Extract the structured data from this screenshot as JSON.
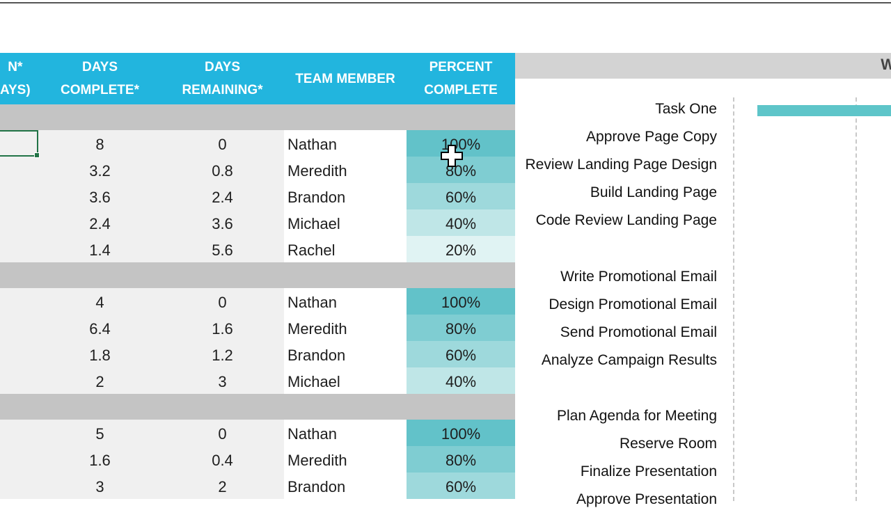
{
  "header": {
    "duration": [
      "N*",
      "AYS)"
    ],
    "days_complete": [
      "DAYS",
      "COMPLETE*"
    ],
    "days_remaining": [
      "DAYS",
      "REMAINING*"
    ],
    "team_member": "TEAM MEMBER",
    "percent_complete": [
      "PERCENT",
      "COMPLETE"
    ],
    "gantt_title_partial": "W"
  },
  "colors": {
    "header_bg": "#22b5de",
    "section_bar": "#c4c4c4",
    "gantt_bar": "#5ec5c9",
    "pc_100": "#62c2c9",
    "pc_80": "#7fcdd2",
    "pc_60": "#9ed9dc",
    "pc_40": "#bfe6e7",
    "pc_20": "#e0f3f3",
    "selection": "#217346"
  },
  "sections": [
    {
      "rows": [
        {
          "days_complete": "8",
          "days_remaining": "0",
          "team_member": "Nathan",
          "percent": "100%",
          "pct": 100
        },
        {
          "days_complete": "3.2",
          "days_remaining": "0.8",
          "team_member": "Meredith",
          "percent": "80%",
          "pct": 80
        },
        {
          "days_complete": "3.6",
          "days_remaining": "2.4",
          "team_member": "Brandon",
          "percent": "60%",
          "pct": 60
        },
        {
          "days_complete": "2.4",
          "days_remaining": "3.6",
          "team_member": "Michael",
          "percent": "40%",
          "pct": 40
        },
        {
          "days_complete": "1.4",
          "days_remaining": "5.6",
          "team_member": "Rachel",
          "percent": "20%",
          "pct": 20
        }
      ]
    },
    {
      "rows": [
        {
          "days_complete": "4",
          "days_remaining": "0",
          "team_member": "Nathan",
          "percent": "100%",
          "pct": 100
        },
        {
          "days_complete": "6.4",
          "days_remaining": "1.6",
          "team_member": "Meredith",
          "percent": "80%",
          "pct": 80
        },
        {
          "days_complete": "1.8",
          "days_remaining": "1.2",
          "team_member": "Brandon",
          "percent": "60%",
          "pct": 60
        },
        {
          "days_complete": "2",
          "days_remaining": "3",
          "team_member": "Michael",
          "percent": "40%",
          "pct": 40
        }
      ]
    },
    {
      "rows": [
        {
          "days_complete": "5",
          "days_remaining": "0",
          "team_member": "Nathan",
          "percent": "100%",
          "pct": 100
        },
        {
          "days_complete": "1.6",
          "days_remaining": "0.4",
          "team_member": "Meredith",
          "percent": "80%",
          "pct": 80
        },
        {
          "days_complete": "3",
          "days_remaining": "2",
          "team_member": "Brandon",
          "percent": "60%",
          "pct": 60
        }
      ]
    }
  ],
  "gantt": {
    "tasks": [
      "Task One",
      "Approve Page Copy",
      "Review Landing Page Design",
      "Build Landing Page",
      "Code Review Landing Page",
      "",
      "Write Promotional Email",
      "Design Promotional Email",
      "Send Promotional Email",
      "Analyze Campaign Results",
      "",
      "Plan Agenda for Meeting",
      "Reserve Room",
      "Finalize Presentation",
      "Approve Presentation"
    ],
    "bars": [
      {
        "task": "Task One"
      }
    ]
  }
}
